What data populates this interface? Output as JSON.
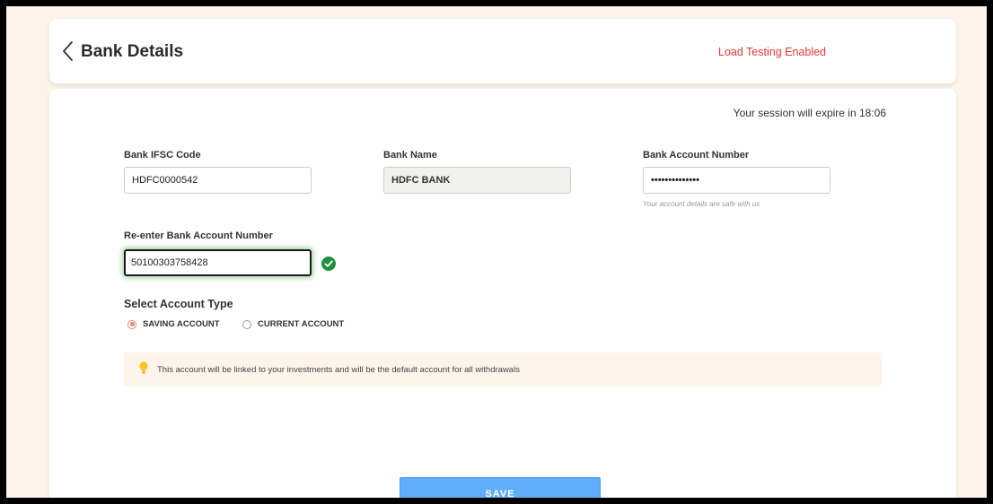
{
  "header": {
    "title": "Bank Details",
    "load_testing": "Load Testing Enabled",
    "back_icon": "chevron-left-icon"
  },
  "session": {
    "text": "Your session will expire in 18:06"
  },
  "form": {
    "ifsc": {
      "label": "Bank IFSC Code",
      "value": "HDFC0000542"
    },
    "bank_name": {
      "label": "Bank Name",
      "value": "HDFC BANK"
    },
    "account_number": {
      "label": "Bank Account Number",
      "value": "••••••••••••••",
      "hint": "Your account details are safe with us"
    },
    "reenter_account": {
      "label": "Re-enter Bank Account Number",
      "value": "50100303758428",
      "status_icon": "check-circle-icon"
    },
    "account_type": {
      "title": "Select Account Type",
      "options": [
        {
          "label": "SAVING ACCOUNT",
          "selected": true
        },
        {
          "label": "CURRENT ACCOUNT",
          "selected": false
        }
      ]
    }
  },
  "info": {
    "icon": "lightbulb-icon",
    "text": "This account will be linked to your investments and will be the default account for all withdrawals"
  },
  "actions": {
    "save_label": "SAVE"
  },
  "colors": {
    "background": "#fdf5ec",
    "accent_red": "#e53935",
    "save_button": "#60adfb",
    "check_green": "#1e8e3e",
    "radio_selected": "#e48b6c"
  }
}
